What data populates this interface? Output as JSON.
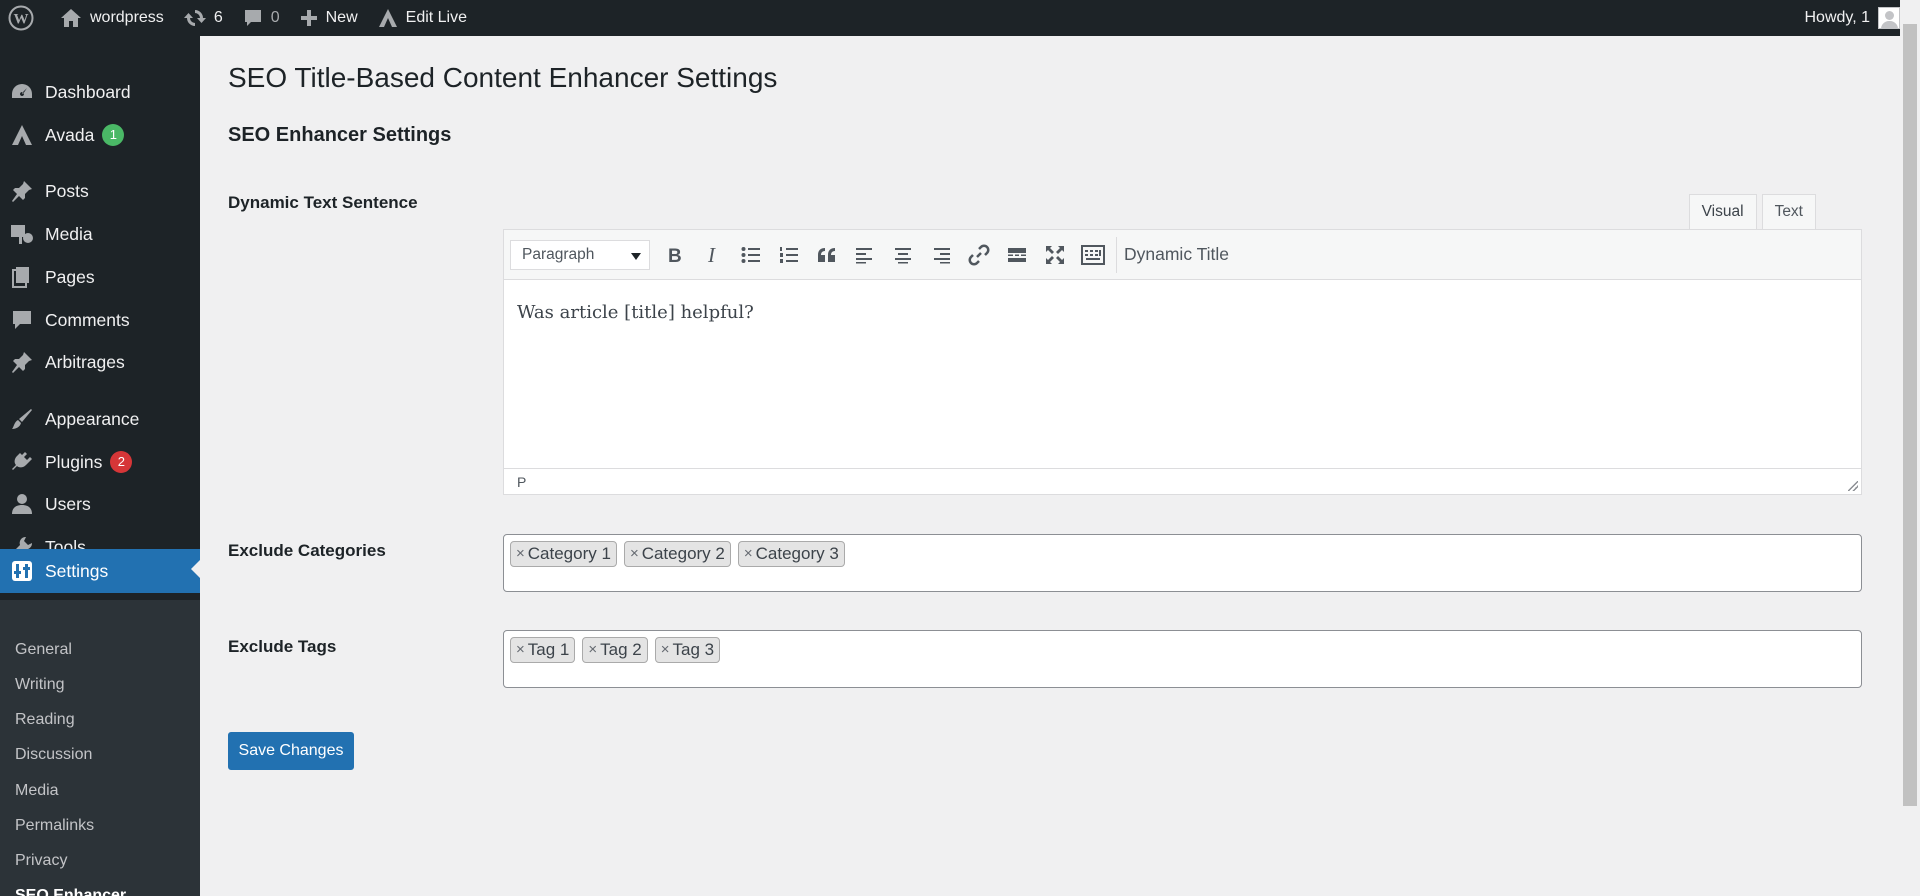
{
  "admin_bar": {
    "site_name": "wordpress",
    "updates_count": "6",
    "comments_count": "0",
    "new_label": "New",
    "edit_live_label": "Edit Live",
    "howdy": "Howdy, 1"
  },
  "sidebar": {
    "items": [
      {
        "label": "Dashboard",
        "icon": "dashboard-icon"
      },
      {
        "label": "Avada",
        "icon": "avada-icon",
        "badge": "1"
      },
      {
        "label": "Posts",
        "icon": "pin-icon"
      },
      {
        "label": "Media",
        "icon": "media-icon"
      },
      {
        "label": "Pages",
        "icon": "pages-icon"
      },
      {
        "label": "Comments",
        "icon": "comment-icon"
      },
      {
        "label": "Arbitrages",
        "icon": "pin-icon"
      },
      {
        "label": "Appearance",
        "icon": "brush-icon"
      },
      {
        "label": "Plugins",
        "icon": "plugin-icon",
        "badge": "2"
      },
      {
        "label": "Users",
        "icon": "user-icon"
      },
      {
        "label": "Tools",
        "icon": "wrench-icon"
      },
      {
        "label": "Settings",
        "icon": "settings-icon"
      }
    ],
    "submenu": [
      "General",
      "Writing",
      "Reading",
      "Discussion",
      "Media",
      "Permalinks",
      "Privacy",
      "SEO Enhancer"
    ],
    "badge_colors": {
      "avada": "#4ab866",
      "plugins": "#d63638"
    },
    "accent": "#2271b1"
  },
  "main": {
    "page_title": "SEO Title-Based Content Enhancer Settings",
    "section_title": "SEO Enhancer Settings",
    "dynamic_text": {
      "label": "Dynamic Text Sentence",
      "tabs": [
        "Visual",
        "Text"
      ],
      "active_tab": "Visual",
      "format_select": "Paragraph",
      "dynamic_title_button": "Dynamic Title",
      "content": "Was article [title] helpful?",
      "status_path": "P"
    },
    "exclude_categories": {
      "label": "Exclude Categories",
      "tokens": [
        "Category 1",
        "Category 2",
        "Category 3"
      ]
    },
    "exclude_tags": {
      "label": "Exclude Tags",
      "tokens": [
        "Tag 1",
        "Tag 2",
        "Tag 3"
      ]
    },
    "token_remove_glyph": "×",
    "save_button": "Save Changes"
  }
}
